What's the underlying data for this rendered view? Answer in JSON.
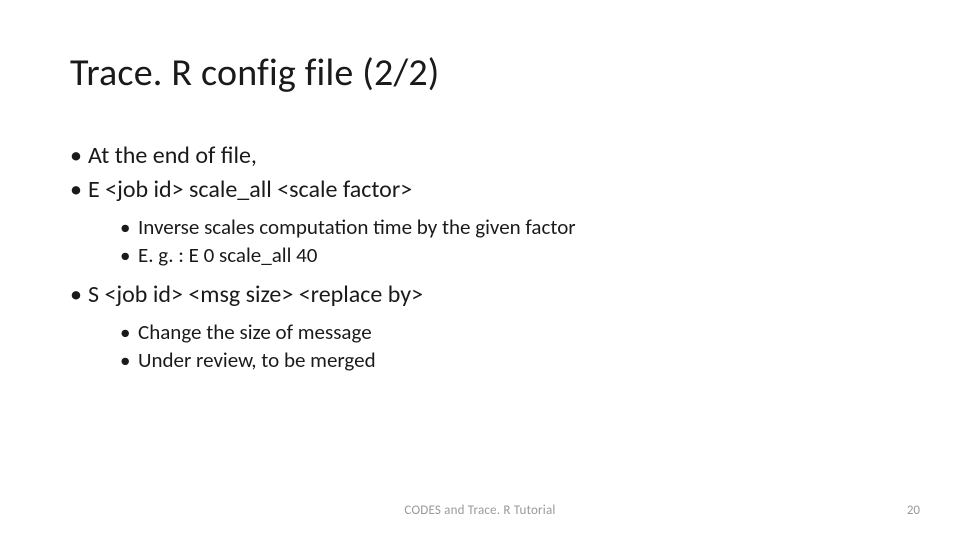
{
  "title": "Trace. R config file (2/2)",
  "bullets": {
    "b0": "At the end of file,",
    "b1": "E <job id> scale_all <scale factor>",
    "b1_sub0": "Inverse scales computation time by the given factor",
    "b1_sub1": "E. g. : E 0 scale_all 40",
    "b2": "S <job id> <msg size> <replace by>",
    "b2_sub0": "Change the size of message",
    "b2_sub1": "Under review, to be merged"
  },
  "footer": {
    "center": "CODES and Trace. R Tutorial",
    "page": "20"
  }
}
